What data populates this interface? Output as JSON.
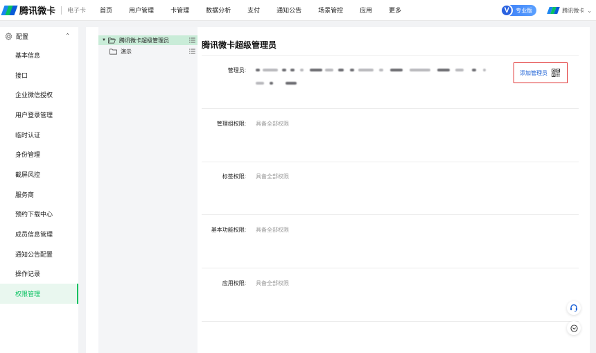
{
  "header": {
    "app_name": "腾讯微卡",
    "product_name": "电子卡",
    "nav": [
      "首页",
      "用户管理",
      "卡管理",
      "数据分析",
      "支付",
      "通知公告",
      "场景管控",
      "应用",
      "更多"
    ],
    "edition_label": "专业版",
    "org_name": "腾讯微卡"
  },
  "sidebar": {
    "section_label": "配置",
    "items": [
      "基本信息",
      "接口",
      "企业微信授权",
      "用户登录管理",
      "临时认证",
      "身份管理",
      "截屏风控",
      "服务商",
      "预约下载中心",
      "成员信息管理",
      "通知公告配置",
      "操作记录",
      "权限管理"
    ],
    "active_index": 12
  },
  "tree": {
    "root": "腾讯微卡超级管理员",
    "child": "演示"
  },
  "main": {
    "title": "腾讯微卡超级管理员",
    "admin_label": "管理员:",
    "add_admin": "添加管理员",
    "rows": [
      {
        "label": "管理组权限:",
        "value": "具备全部权限"
      },
      {
        "label": "标签权限:",
        "value": "具备全部权限"
      },
      {
        "label": "基本功能权限:",
        "value": "具备全部权限"
      },
      {
        "label": "应用权限:",
        "value": "具备全部权限"
      }
    ]
  },
  "icons": {
    "gear": "gear-icon",
    "folder": "folder-icon",
    "menu": "list-menu-icon",
    "qr": "qr-code-icon",
    "support": "headset-icon",
    "scroll": "chevron-down-circle-icon"
  },
  "colors": {
    "brand_green": "#07c160",
    "link_blue": "#1d62d6",
    "highlight_red": "#e02e2e"
  }
}
